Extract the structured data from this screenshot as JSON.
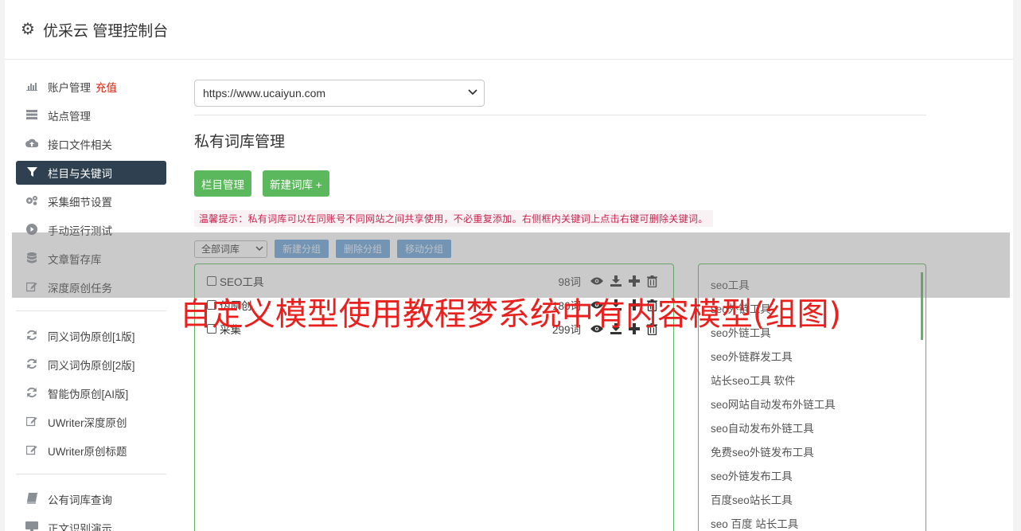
{
  "header": {
    "title": "优采云 管理控制台",
    "icon": "gear-icon"
  },
  "sidebar": {
    "items": [
      {
        "label": "账户管理",
        "extra": "充值",
        "icon": "bar-chart-icon"
      },
      {
        "label": "站点管理",
        "icon": "server-icon"
      },
      {
        "label": "接口文件相关",
        "icon": "cloud-upload-icon"
      },
      {
        "label": "栏目与关键词",
        "icon": "filter-icon",
        "active": true
      },
      {
        "label": "采集细节设置",
        "icon": "gears-icon"
      },
      {
        "label": "手动运行测试",
        "icon": "play-circle-icon"
      },
      {
        "label": "文章暂存库",
        "icon": "database-icon"
      },
      {
        "label": "深度原创任务",
        "icon": "edit-icon"
      },
      {
        "label": "同义词伪原创[1版]",
        "icon": "refresh-icon"
      },
      {
        "label": "同义词伪原创[2版]",
        "icon": "refresh-icon"
      },
      {
        "label": "智能伪原创[AI版]",
        "icon": "refresh-icon"
      },
      {
        "label": "UWriter深度原创",
        "icon": "edit-icon"
      },
      {
        "label": "UWriter原创标题",
        "icon": "edit-icon"
      },
      {
        "label": "公有词库查询",
        "icon": "book-icon"
      },
      {
        "label": "正文识别演示",
        "icon": "desktop-icon"
      }
    ]
  },
  "main": {
    "site_select": "https://www.ucaiyun.com",
    "heading": "私有词库管理",
    "buttons": {
      "manage_columns": "栏目管理",
      "new_library": "新建词库 +"
    },
    "tip": "温馨提示：私有词库可以在同账号不同网站之间共享使用，不必重复添加。右侧框内关键词上点击右键可删除关键词。",
    "toolbar": {
      "all_libraries": "全部词库",
      "new_group": "新建分组",
      "delete_group": "删除分组",
      "move_group": "移动分组"
    },
    "groups": [
      {
        "name": "SEO工具",
        "count": "98词"
      },
      {
        "name": "伪原创",
        "count": "186词"
      },
      {
        "name": "采集",
        "count": "299词"
      }
    ],
    "keywords": [
      "seo工具",
      "seo外链工具",
      "seo外链工具",
      "seo外链群发工具",
      "站长seo工具 软件",
      "seo网站自动发布外链工具",
      "seo自动发布外链工具",
      "免费seo外链发布工具",
      "seo外链发布工具",
      "百度seo站长工具",
      "seo 百度 站长工具"
    ]
  },
  "overlay": {
    "title": "自定义模型使用教程梦系统中有内容模型(组图)"
  }
}
